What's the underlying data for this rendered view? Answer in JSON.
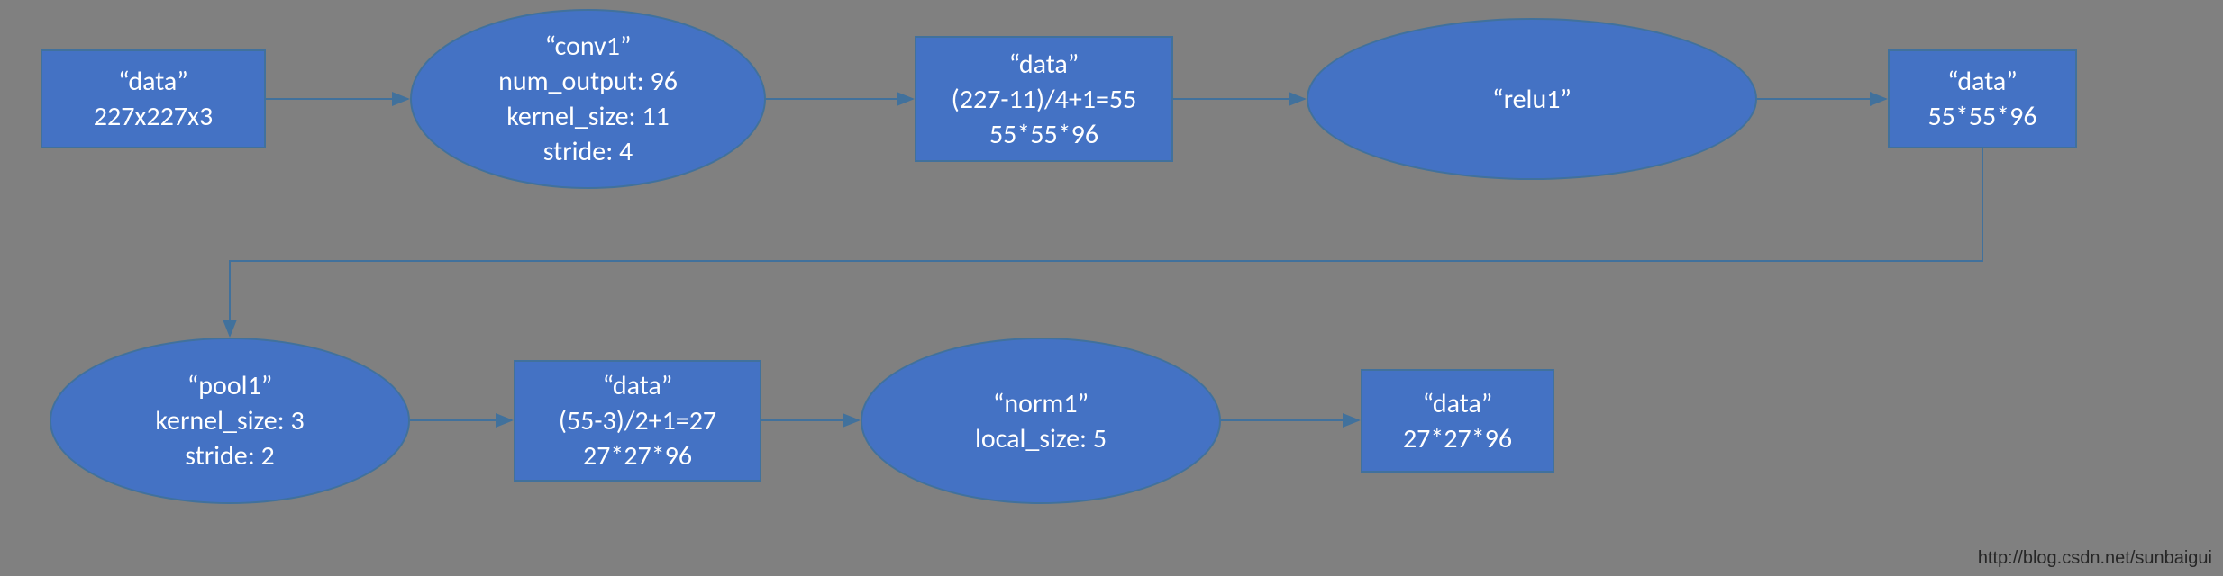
{
  "nodes": {
    "n1": {
      "title": "“data”",
      "line1": "227x227x3"
    },
    "n2": {
      "title": "“conv1”",
      "line1": "num_output: 96",
      "line2": "kernel_size: 11",
      "line3": "stride: 4"
    },
    "n3": {
      "title": "“data”",
      "line1": "(227-11)/4+1=55",
      "line2": "55*55*96"
    },
    "n4": {
      "title": "“relu1”"
    },
    "n5": {
      "title": "“data”",
      "line1": "55*55*96"
    },
    "n6": {
      "title": "“pool1”",
      "line1": "kernel_size: 3",
      "line2": "stride: 2"
    },
    "n7": {
      "title": "“data”",
      "line1": "(55-3)/2+1=27",
      "line2": "27*27*96"
    },
    "n8": {
      "title": "“norm1”",
      "line1": "local_size: 5"
    },
    "n9": {
      "title": "“data”",
      "line1": "27*27*96"
    }
  },
  "watermark": "http://blog.csdn.net/sunbaigui"
}
